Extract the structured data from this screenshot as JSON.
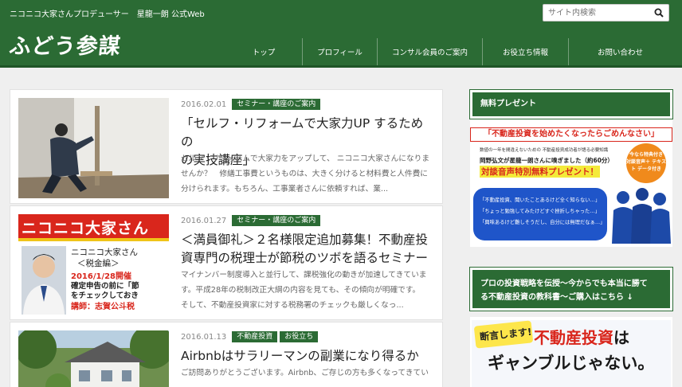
{
  "header": {
    "tagline": "ニコニコ大家さんプロデューサー　星龍一朗 公式Web",
    "search_placeholder": "サイト内検索",
    "logo_text": "ふどう参謀",
    "nav": [
      "トップ",
      "プロフィール",
      "コンサル会員のご案内",
      "お役立ち情報",
      "お問い合わせ"
    ]
  },
  "posts": [
    {
      "date": "2016.02.01",
      "tags": [
        "セミナー・講座のご案内"
      ],
      "title_line1": "「セルフ・リフォームで大家力UP するための",
      "title_line2": "の実技講座」",
      "excerpt_line1": "セルフ・リフォームで大家力をアップして、 ニコニコ大家さんになりま",
      "excerpt_line2": "せんか？　修繕工事費というものは、大きく分けると材料費と人件費に",
      "excerpt_line3": "分けられます。もちろん、工事業者さんに依頼すれば、業..."
    },
    {
      "date": "2016.01.27",
      "tags": [
        "セミナー・講座のご案内"
      ],
      "title_line1": "＜満員御礼＞２名様限定追加募集！不動産投",
      "title_line2": "資専門の税理士が節税のツボを語るセミナー",
      "excerpt_line1": "マイナンバー制度導入と並行して、課税強化の動きが加速してきていま",
      "excerpt_line2": "す。平成28年の税制改正大綱の内容を見ても、その傾向が明確です。",
      "excerpt_line3": "そして、不動産投資家に対する税務署のチェックも厳しくなっ...",
      "thumb_heading": "ニコニコ大家さん",
      "thumb_sub1": "ニコニコ大家さん",
      "thumb_sub2": "＜税金編＞",
      "thumb_date": "2016/1/28開催",
      "thumb_line1": "確定申告の前に「節",
      "thumb_line2": "をチェックしておき",
      "thumb_speaker": "講師：志賀公斗税"
    },
    {
      "date": "2016.01.13",
      "tags": [
        "不動産投資",
        "お役立ち"
      ],
      "title_line1": "Airbnbはサラリーマンの副業になり得るか",
      "excerpt_line1": "ご訪問ありがとうございます。Airbnb、ご存じの方も多くなってきてい"
    }
  ],
  "sidebar": {
    "present_heading": "無料プレゼント",
    "present_banner": {
      "headline": "「不動産投資を始めたくなったらごめんなさい」",
      "small": "数値の一年を間違えないための 不動産投資成功者が語る必要知識",
      "name_line": "岡野弘文が星龍一朗さんに嗅ぎました（約60分）",
      "offer": "対談音声特別無料プレゼント！",
      "badge": "今なら特典付き 対談音声＋ テキスト データ付き",
      "bubble1": "「不動産投資、聞いたことあるけど全く知らない…」",
      "bubble2": "「ちょっと勉強してみたけどすぐ挫折しちゃった…」",
      "bubble3": "「興味あるけど難しそうだし、自分には無理だなぁ…」"
    },
    "book_heading_line1": "プロの投資戦略を伝授〜今からでも本当に勝て",
    "book_heading_line2": "る不動産投資の教科書〜ご購入はこちら ↓",
    "book_banner": {
      "burst": "断言します!",
      "line1_red": "不動産投資",
      "line1_black": "は",
      "line2": "ギャンブルじゃない。"
    }
  },
  "colors": {
    "brand_green": "#2b6b34",
    "accent_red": "#d9261c",
    "background": "#efefef"
  }
}
